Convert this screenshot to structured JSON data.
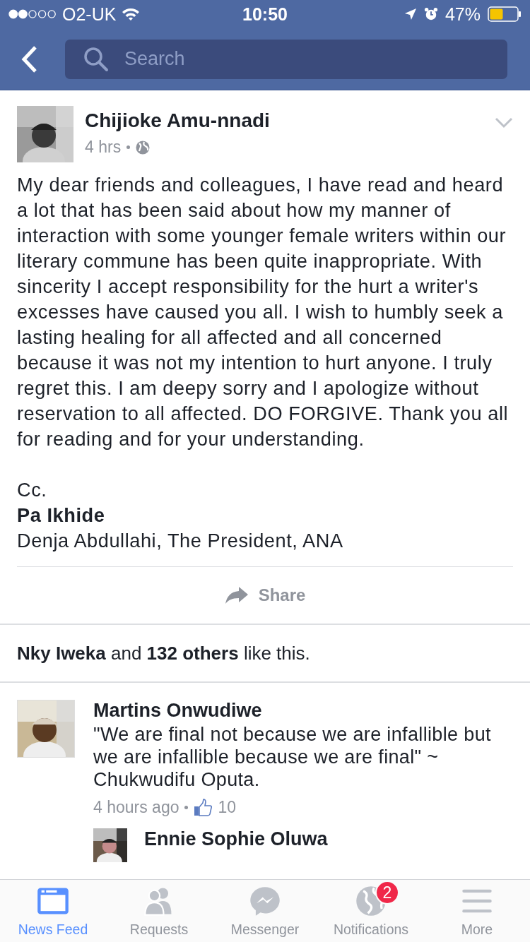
{
  "status_bar": {
    "carrier": "O2-UK",
    "time": "10:50",
    "battery": "47%"
  },
  "search": {
    "placeholder": "Search"
  },
  "post": {
    "author": "Chijioke Amu-nnadi",
    "time": "4 hrs",
    "body": "My dear friends and colleagues, I have read and heard a lot that has been said about how my manner of interaction with some younger female writers within our literary commune has been quite inappropriate. With sincerity I accept responsibility for the hurt a writer's excesses have caused you all. I wish to humbly seek a lasting healing for all affected and all concerned because it was not my intention to hurt anyone. I truly regret this. I am deepy sorry and I apologize without reservation to all affected. DO FORGIVE. Thank you all for reading and for your understanding.",
    "cc_lines": [
      {
        "text": "Cc.",
        "bold": false
      },
      {
        "text": "Pa Ikhide",
        "bold": true
      },
      {
        "text": "Denja Abdullahi, The President, ANA",
        "bold": false
      }
    ],
    "share_label": "Share"
  },
  "likes": "**Nky Iweka** and **132 others** like this.",
  "comments": [
    {
      "author": "Martins Onwudiwe",
      "text": "\"We are final not because we are infallible but we are infallible because we are final\" ~ Chukwudifu Oputa.",
      "time": "4 hours ago",
      "like_count": "10",
      "replies": [
        {
          "author": "Ennie Sophie Oluwa"
        }
      ]
    }
  ],
  "tab_bar": [
    {
      "kind": "feed",
      "label": "News Feed",
      "selected": true
    },
    {
      "kind": "people",
      "label": "Requests",
      "selected": false
    },
    {
      "kind": "messenger",
      "label": "Messenger",
      "selected": false
    },
    {
      "kind": "globe",
      "label": "Notifications",
      "selected": false,
      "badge": "2"
    },
    {
      "kind": "menu",
      "label": "More",
      "selected": false
    }
  ]
}
